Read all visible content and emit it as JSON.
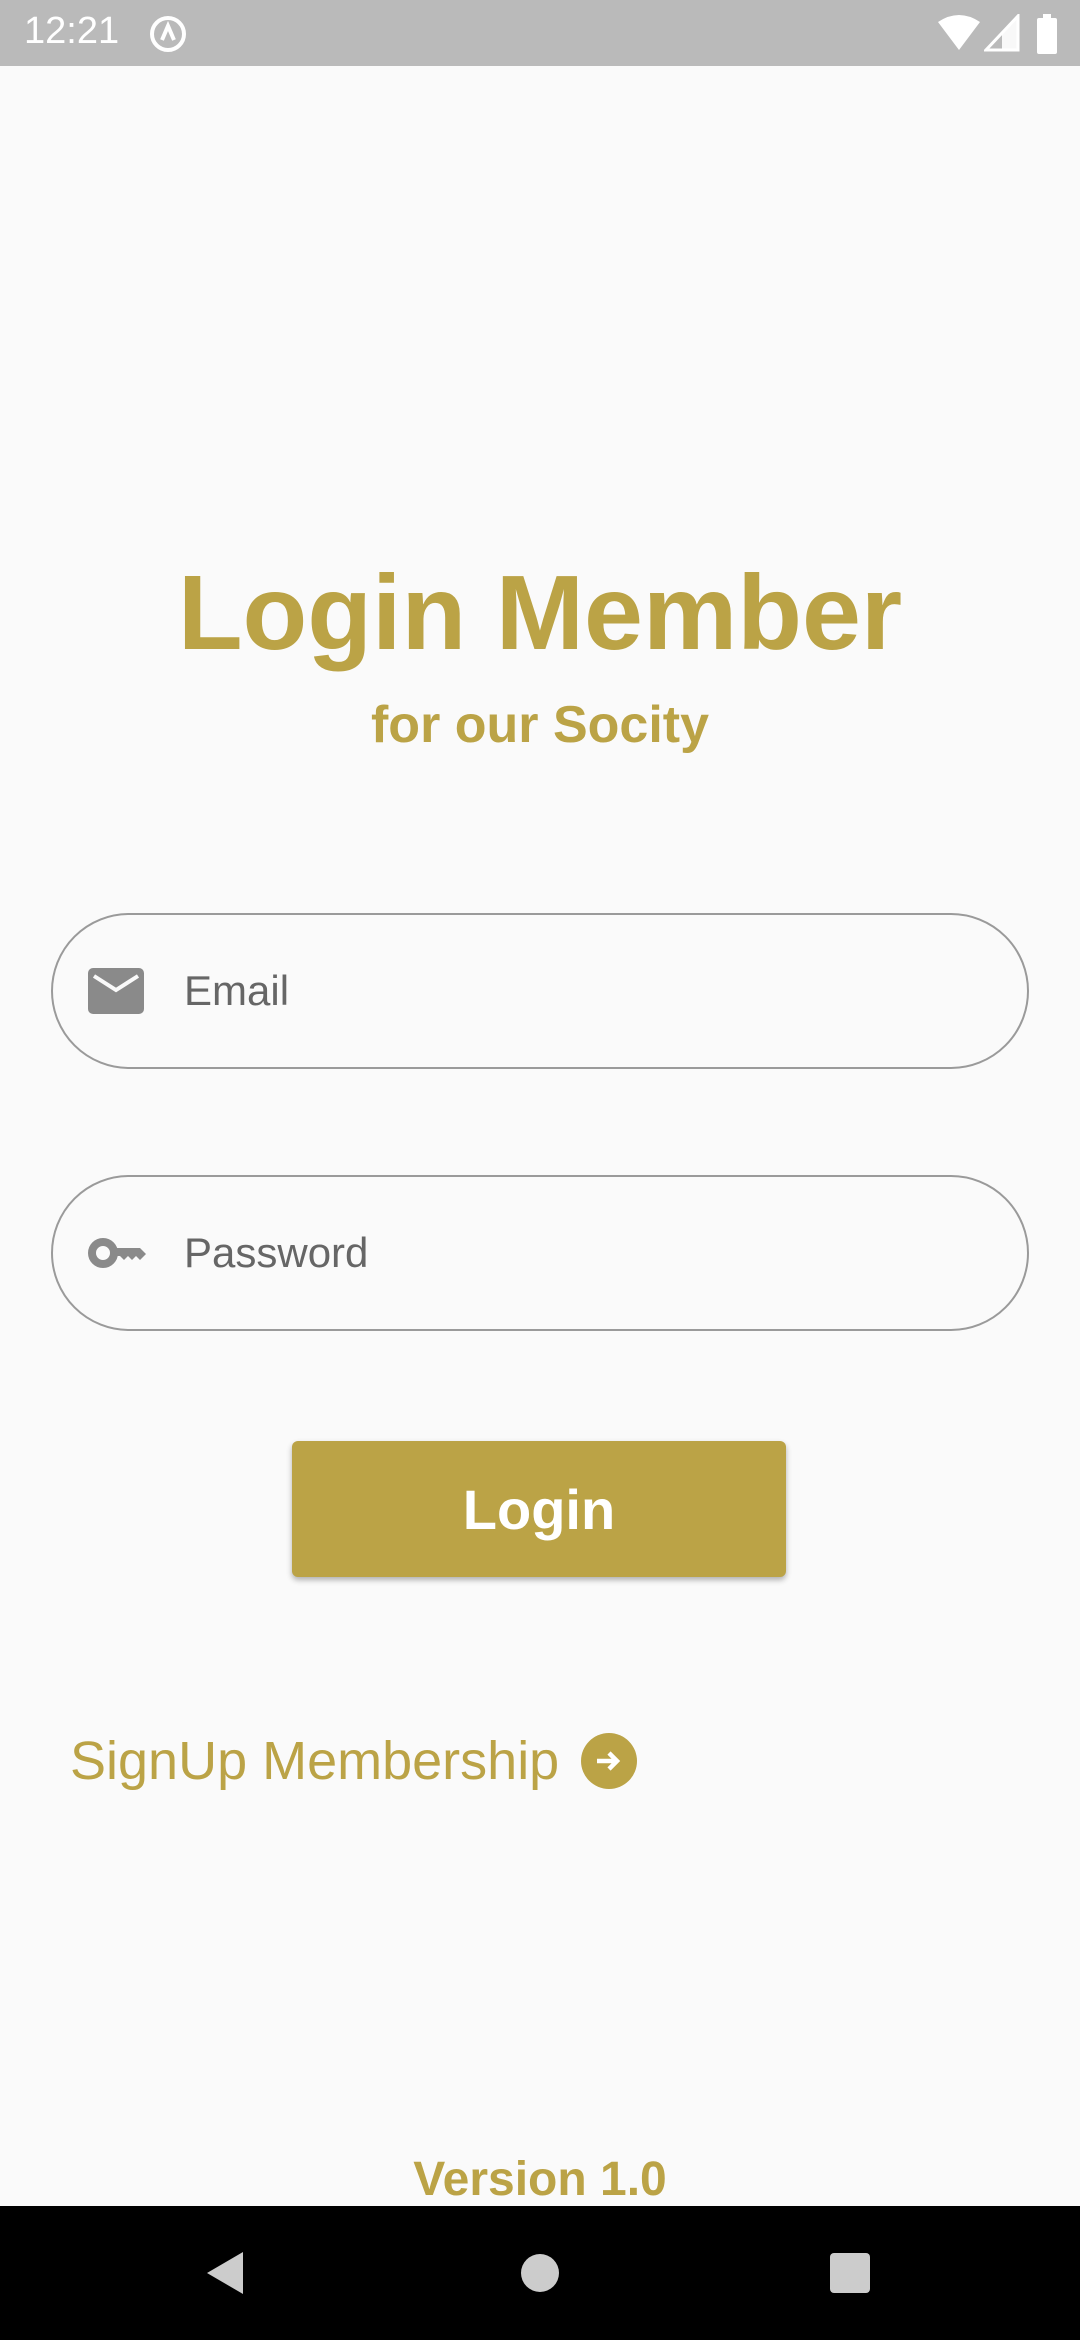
{
  "status_bar": {
    "time": "12:21"
  },
  "header": {
    "title": "Login Member",
    "subtitle": "for our Socity"
  },
  "form": {
    "email": {
      "placeholder": "Email",
      "icon": "mail-icon"
    },
    "password": {
      "placeholder": "Password",
      "icon": "key-icon"
    },
    "login_label": "Login"
  },
  "signup": {
    "label": "SignUp Membership",
    "icon": "arrow-right-circle-icon"
  },
  "footer": {
    "version": "Version 1.0"
  },
  "colors": {
    "accent": "#bba346",
    "background": "#fafafa",
    "status_bar": "#bababa"
  }
}
